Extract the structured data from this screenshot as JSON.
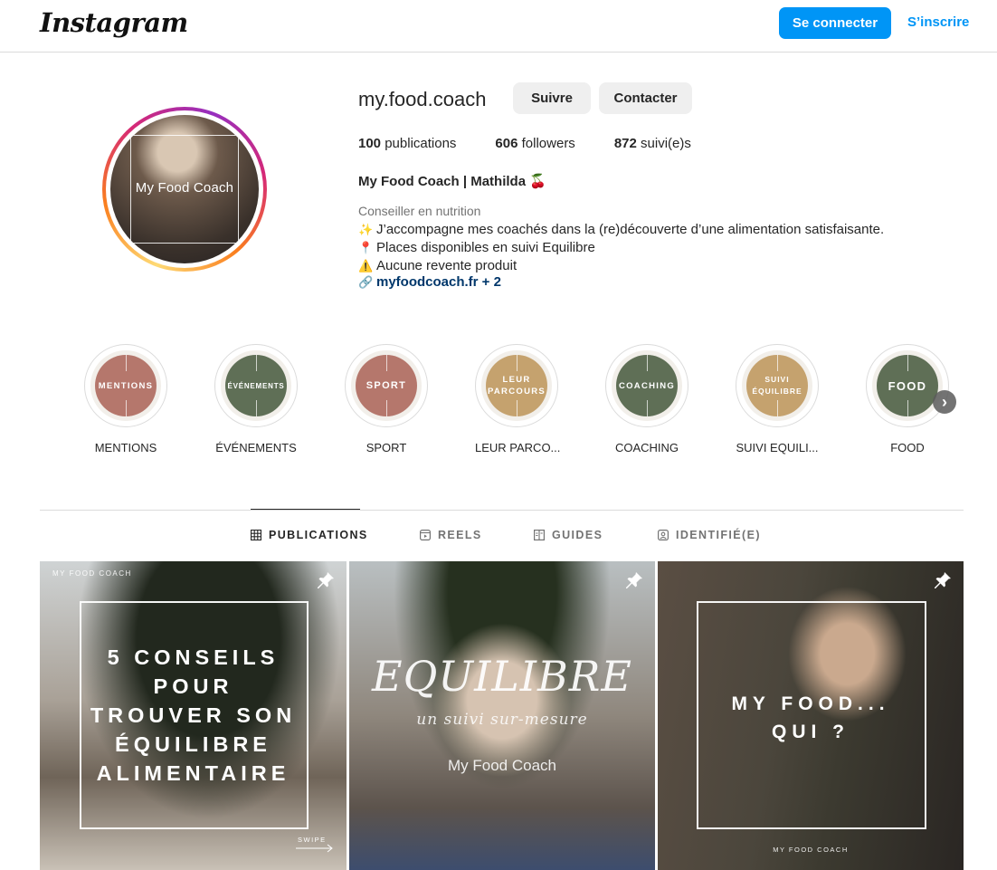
{
  "topbar": {
    "logo": "Instagram",
    "login_label": "Se connecter",
    "signup_label": "S’inscrire"
  },
  "profile": {
    "avatar_text": "My Food Coach",
    "username": "my.food.coach",
    "follow_label": "Suivre",
    "contact_label": "Contacter",
    "stats": {
      "publications_count": "100",
      "publications_label": "publications",
      "followers_count": "606",
      "followers_label": "followers",
      "following_count": "872",
      "following_label": "suivi(e)s"
    },
    "fullname": "My Food Coach | Mathilda 🍒",
    "category": "Conseiller en nutrition",
    "bio": [
      {
        "emoji": "✨",
        "text": "J’accompagne mes coachés dans la (re)découverte d’une alimentation satisfaisante."
      },
      {
        "emoji": "📍",
        "text": "Places disponibles en suivi Equilibre"
      },
      {
        "emoji": "⚠️",
        "text": "Aucune revente produit"
      }
    ],
    "link_icon": "🔗",
    "link_text": "myfoodcoach.fr + 2"
  },
  "highlights": [
    {
      "cover": "MENTIONS",
      "label": "MENTIONS",
      "color": "#b5776c"
    },
    {
      "cover": "ÉVÉNEMENTS",
      "label": "ÉVÉNEMENTS",
      "color": "#5f6f56"
    },
    {
      "cover": "SPORT",
      "label": "SPORT",
      "color": "#b5776c"
    },
    {
      "cover": "LEUR PARCOURS",
      "label": "LEUR PARCO...",
      "color": "#c5a26e"
    },
    {
      "cover": "COACHING",
      "label": "COACHING",
      "color": "#5f6f56"
    },
    {
      "cover": "SUIVI ÉQUILIBRE",
      "label": "SUIVI EQUILI...",
      "color": "#c5a26e"
    },
    {
      "cover": "FOOD",
      "label": "FOOD",
      "color": "#5f6f56"
    }
  ],
  "tabs": [
    {
      "icon": "grid-icon",
      "label": "PUBLICATIONS",
      "active": true
    },
    {
      "icon": "reels-icon",
      "label": "REELS",
      "active": false
    },
    {
      "icon": "guides-icon",
      "label": "GUIDES",
      "active": false
    },
    {
      "icon": "tagged-icon",
      "label": "IDENTIFIÉ(E)",
      "active": false
    }
  ],
  "posts": [
    {
      "brand_top": "MY FOOD COACH",
      "title": "5 CONSEILS POUR TROUVER SON ÉQUILIBRE ALIMENTAIRE",
      "swipe": "SWIPE"
    },
    {
      "title": "EQUILIBRE",
      "subtitle": "un suivi sur-mesure",
      "brand": "My Food Coach"
    },
    {
      "title": "MY FOOD... QUI ?",
      "brand_bottom": "MY FOOD COACH"
    }
  ]
}
